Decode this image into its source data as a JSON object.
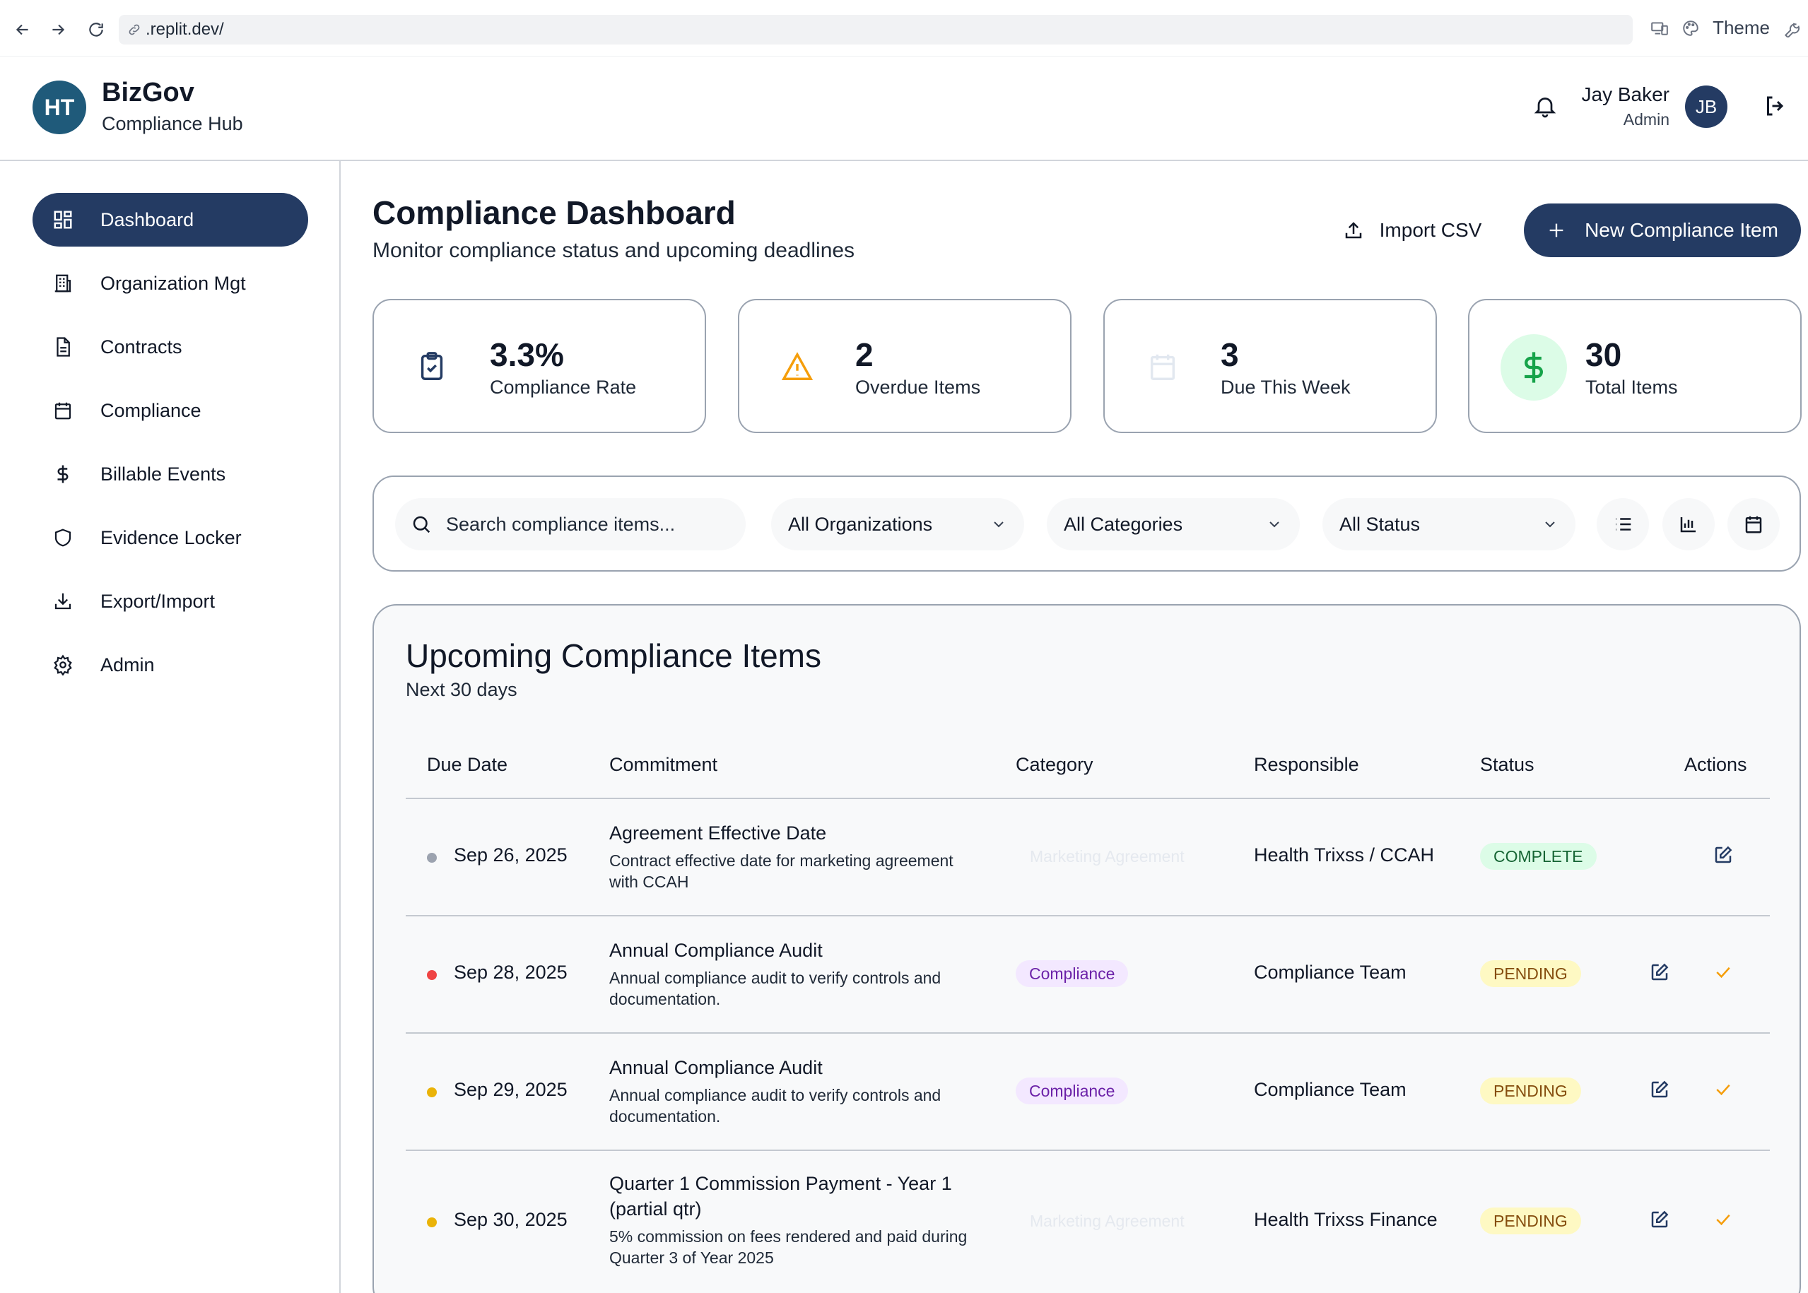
{
  "browser": {
    "url": ".replit.dev/",
    "theme_label": "Theme"
  },
  "header": {
    "logo_initials": "HT",
    "brand_name": "BizGov",
    "brand_subtitle": "Compliance Hub",
    "user_name": "Jay Baker",
    "user_role": "Admin",
    "user_initials": "JB"
  },
  "sidebar": {
    "items": [
      {
        "label": "Dashboard",
        "icon": "grid-icon",
        "active": true
      },
      {
        "label": "Organization Mgt",
        "icon": "building-icon"
      },
      {
        "label": "Contracts",
        "icon": "document-icon"
      },
      {
        "label": "Compliance",
        "icon": "calendar-icon"
      },
      {
        "label": "Billable Events",
        "icon": "dollar-icon"
      },
      {
        "label": "Evidence Locker",
        "icon": "shield-icon"
      },
      {
        "label": "Export/Import",
        "icon": "download-icon"
      },
      {
        "label": "Admin",
        "icon": "gear-icon"
      }
    ]
  },
  "page": {
    "title": "Compliance Dashboard",
    "subtitle": "Monitor compliance status and upcoming deadlines",
    "import_label": "Import CSV",
    "new_item_label": "New Compliance Item"
  },
  "stats": [
    {
      "value": "3.3%",
      "label": "Compliance Rate",
      "icon": "clipboard-check-icon"
    },
    {
      "value": "2",
      "label": "Overdue Items",
      "icon": "warning-icon"
    },
    {
      "value": "3",
      "label": "Due This Week",
      "icon": "calendar-icon"
    },
    {
      "value": "30",
      "label": "Total Items",
      "icon": "dollar-icon"
    }
  ],
  "filters": {
    "search_placeholder": "Search compliance items...",
    "organization": "All Organizations",
    "category": "All Categories",
    "status": "All Status"
  },
  "table": {
    "title": "Upcoming Compliance Items",
    "subtitle": "Next 30 days",
    "columns": [
      "Due Date",
      "Commitment",
      "Category",
      "Responsible",
      "Status",
      "Actions"
    ],
    "rows": [
      {
        "dot_color": "#9ca3af",
        "due_date": "Sep 26, 2025",
        "title": "Agreement Effective Date",
        "description": "Contract effective date for marketing agreement with CCAH",
        "category": "Marketing Agreement",
        "category_style": "faint",
        "responsible": "Health Trixss / CCAH",
        "status": "COMPLETE"
      },
      {
        "dot_color": "#ef4444",
        "due_date": "Sep 28, 2025",
        "title": "Annual Compliance Audit",
        "description": "Annual compliance audit to verify controls and documentation.",
        "category": "Compliance",
        "category_style": "badge",
        "responsible": "Compliance Team",
        "status": "PENDING"
      },
      {
        "dot_color": "#eab308",
        "due_date": "Sep 29, 2025",
        "title": "Annual Compliance Audit",
        "description": "Annual compliance audit to verify controls and documentation.",
        "category": "Compliance",
        "category_style": "badge",
        "responsible": "Compliance Team",
        "status": "PENDING"
      },
      {
        "dot_color": "#eab308",
        "due_date": "Sep 30, 2025",
        "title": "Quarter 1 Commission Payment - Year 1 (partial qtr)",
        "description": "5% commission on fees rendered and paid during Quarter 3 of Year 2025",
        "category": "Marketing Agreement",
        "category_style": "faint",
        "responsible": "Health Trixss Finance",
        "status": "PENDING"
      }
    ]
  },
  "colors": {
    "primary": "#243b63",
    "logo": "#1f5a7a",
    "warning": "#f59e0b",
    "success": "#16a34a"
  }
}
